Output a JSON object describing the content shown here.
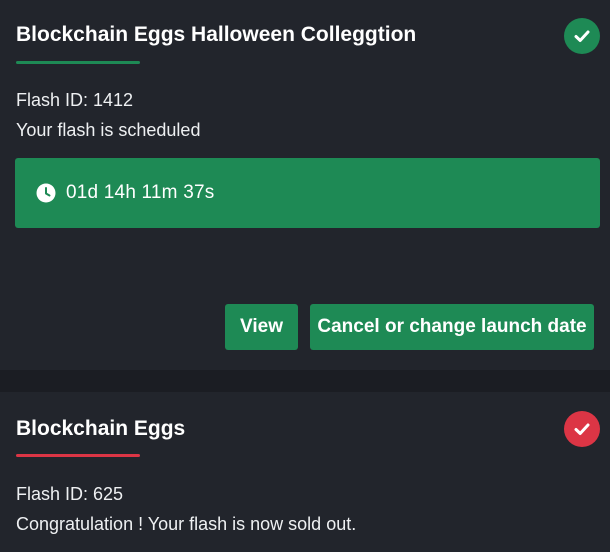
{
  "colors": {
    "success": "#1e8a55",
    "danger": "#dc3545",
    "card_bg": "#22252c",
    "page_bg": "#1b1d23"
  },
  "cards": [
    {
      "title": "Blockchain Eggs Halloween Colleggtion",
      "status_icon": "check-icon",
      "flash_id": "Flash ID: 1412",
      "status_text": "Your flash is scheduled",
      "countdown_icon": "clock-icon",
      "countdown": "01d 14h 11m 37s",
      "buttons": {
        "view": "View",
        "cancel": "Cancel or change launch date"
      }
    },
    {
      "title": "Blockchain Eggs",
      "status_icon": "check-icon",
      "flash_id": "Flash ID: 625",
      "status_text": "Congratulation ! Your flash is now sold out."
    }
  ]
}
